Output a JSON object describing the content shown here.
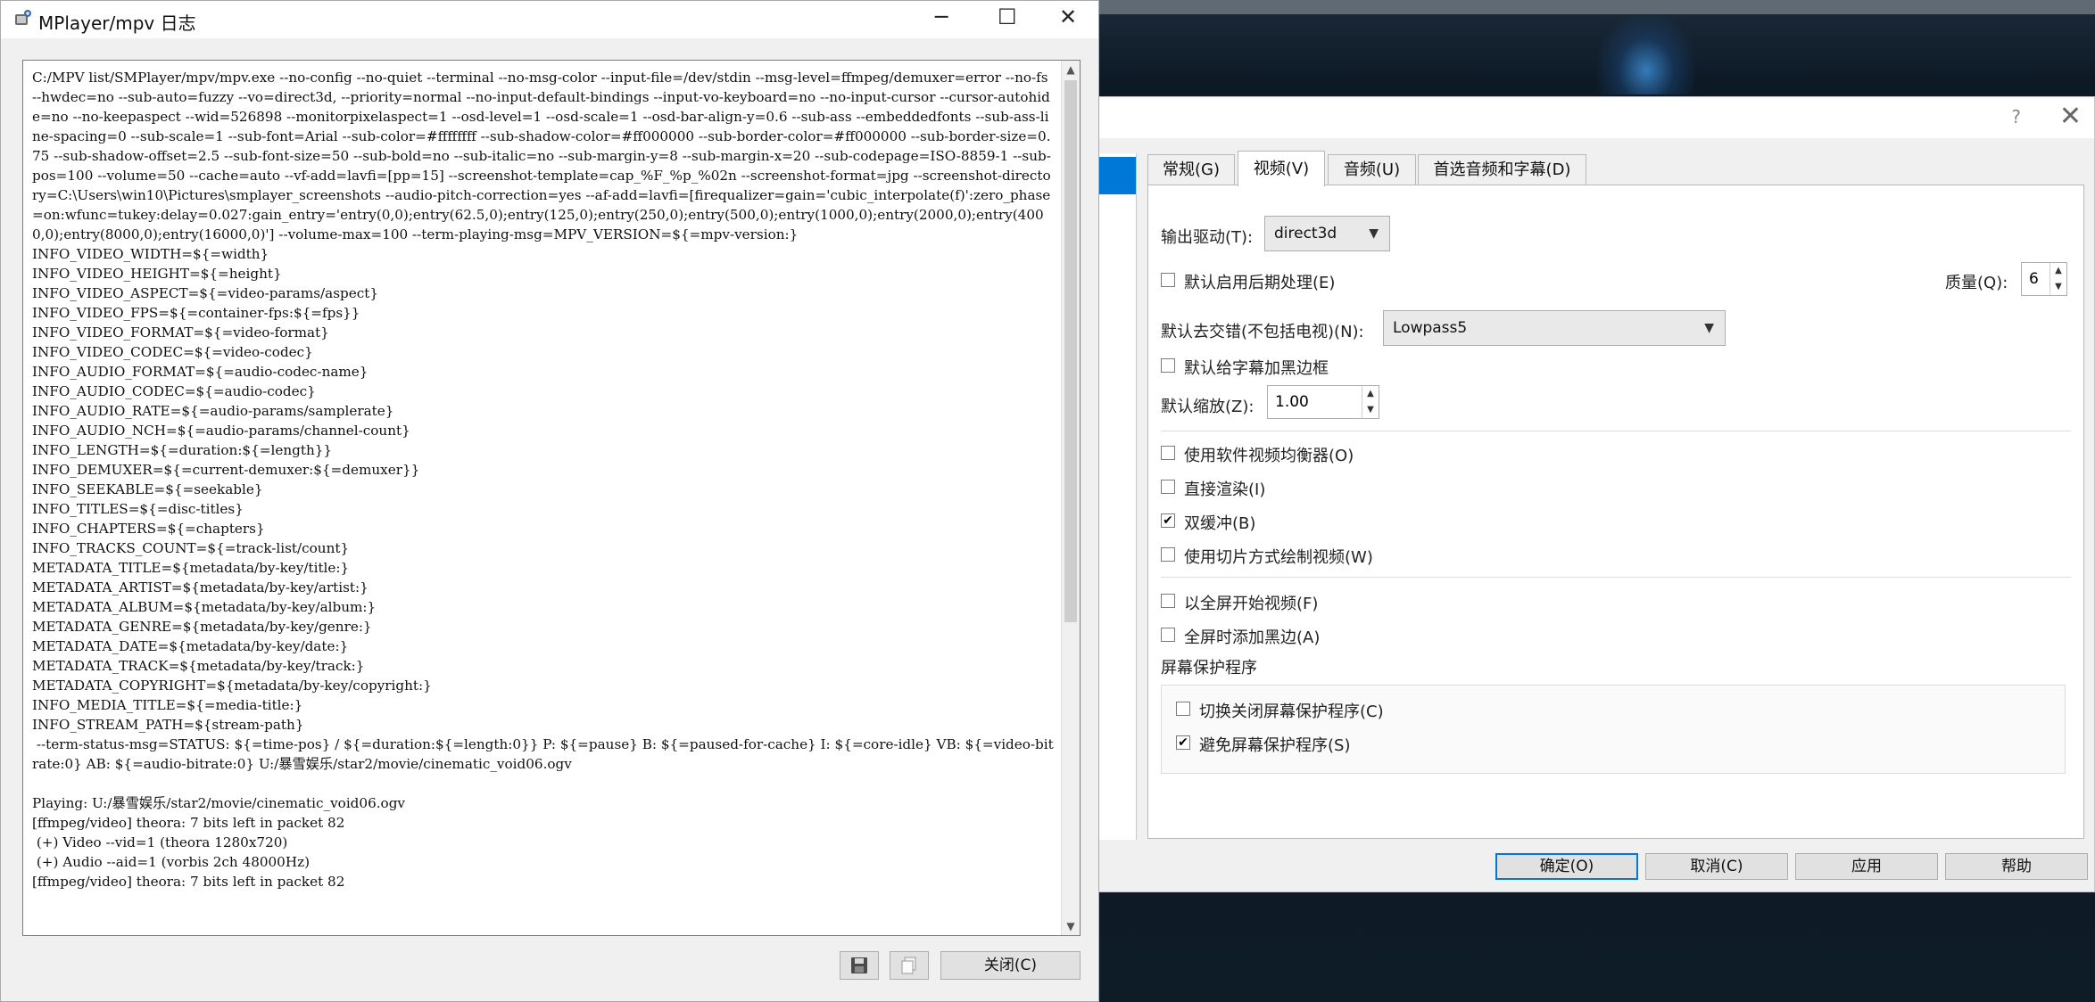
{
  "log_window": {
    "title": "MPlayer/mpv 日志",
    "controls": {
      "minimize": "─",
      "maximize": "☐",
      "close": "✕"
    },
    "log_text": "C:/MPV list/SMPlayer/mpv/mpv.exe --no-config --no-quiet --terminal --no-msg-color --input-file=/dev/stdin --msg-level=ffmpeg/demuxer=error --no-fs --hwdec=no --sub-auto=fuzzy --vo=direct3d, --priority=normal --no-input-default-bindings --input-vo-keyboard=no --no-input-cursor --cursor-autohide=no --no-keepaspect --wid=526898 --monitorpixelaspect=1 --osd-level=1 --osd-scale=1 --osd-bar-align-y=0.6 --sub-ass --embeddedfonts --sub-ass-line-spacing=0 --sub-scale=1 --sub-font=Arial --sub-color=#ffffffff --sub-shadow-color=#ff000000 --sub-border-color=#ff000000 --sub-border-size=0.75 --sub-shadow-offset=2.5 --sub-font-size=50 --sub-bold=no --sub-italic=no --sub-margin-y=8 --sub-margin-x=20 --sub-codepage=ISO-8859-1 --sub-pos=100 --volume=50 --cache=auto --vf-add=lavfi=[pp=15] --screenshot-template=cap_%F_%p_%02n --screenshot-format=jpg --screenshot-directory=C:\\Users\\win10\\Pictures\\smplayer_screenshots --audio-pitch-correction=yes --af-add=lavfi=[firequalizer=gain='cubic_interpolate(f)':zero_phase=on:wfunc=tukey:delay=0.027:gain_entry='entry(0,0);entry(62.5,0);entry(125,0);entry(250,0);entry(500,0);entry(1000,0);entry(2000,0);entry(4000,0);entry(8000,0);entry(16000,0)'] --volume-max=100 --term-playing-msg=MPV_VERSION=${=mpv-version:}\nINFO_VIDEO_WIDTH=${=width}\nINFO_VIDEO_HEIGHT=${=height}\nINFO_VIDEO_ASPECT=${=video-params/aspect}\nINFO_VIDEO_FPS=${=container-fps:${=fps}}\nINFO_VIDEO_FORMAT=${=video-format}\nINFO_VIDEO_CODEC=${=video-codec}\nINFO_AUDIO_FORMAT=${=audio-codec-name}\nINFO_AUDIO_CODEC=${=audio-codec}\nINFO_AUDIO_RATE=${=audio-params/samplerate}\nINFO_AUDIO_NCH=${=audio-params/channel-count}\nINFO_LENGTH=${=duration:${=length}}\nINFO_DEMUXER=${=current-demuxer:${=demuxer}}\nINFO_SEEKABLE=${=seekable}\nINFO_TITLES=${=disc-titles}\nINFO_CHAPTERS=${=chapters}\nINFO_TRACKS_COUNT=${=track-list/count}\nMETADATA_TITLE=${metadata/by-key/title:}\nMETADATA_ARTIST=${metadata/by-key/artist:}\nMETADATA_ALBUM=${metadata/by-key/album:}\nMETADATA_GENRE=${metadata/by-key/genre:}\nMETADATA_DATE=${metadata/by-key/date:}\nMETADATA_TRACK=${metadata/by-key/track:}\nMETADATA_COPYRIGHT=${metadata/by-key/copyright:}\nINFO_MEDIA_TITLE=${=media-title:}\nINFO_STREAM_PATH=${stream-path}\n --term-status-msg=STATUS: ${=time-pos} / ${=duration:${=length:0}} P: ${=pause} B: ${=paused-for-cache} I: ${=core-idle} VB: ${=video-bitrate:0} AB: ${=audio-bitrate:0} U:/暴雪娱乐/star2/movie/cinematic_void06.ogv\n\nPlaying: U:/暴雪娱乐/star2/movie/cinematic_void06.ogv\n[ffmpeg/video] theora: 7 bits left in packet 82\n (+) Video --vid=1 (theora 1280x720)\n (+) Audio --aid=1 (vorbis 2ch 48000Hz)\n[ffmpeg/video] theora: 7 bits left in packet 82",
    "buttons": {
      "save_icon": "save-icon",
      "copy_icon": "copy-icon",
      "close_label": "关闭(C)"
    }
  },
  "preferences": {
    "help_glyph": "?",
    "close_glyph": "✕",
    "tabs": [
      "常规(G)",
      "视频(V)",
      "音频(U)",
      "首选音频和字幕(D)"
    ],
    "active_tab": "视频(V)",
    "output_driver_label": "输出驱动(T):",
    "output_driver_value": "direct3d",
    "postprocessing_label": "默认启用后期处理(E)",
    "postprocessing_checked": false,
    "quality_label": "质量(Q):",
    "quality_value": "6",
    "deinterlace_label": "默认去交错(不包括电视)(N):",
    "deinterlace_value": "Lowpass5",
    "sub_black_border_label": "默认给字幕加黑边框",
    "sub_black_border_checked": false,
    "zoom_label": "默认缩放(Z):",
    "zoom_value": "1.00",
    "software_eq_label": "使用软件视频均衡器(O)",
    "software_eq_checked": false,
    "direct_render_label": "直接渲染(I)",
    "direct_render_checked": false,
    "double_buffer_label": "双缓冲(B)",
    "double_buffer_checked": true,
    "slices_label": "使用切片方式绘制视频(W)",
    "slices_checked": false,
    "start_fullscreen_label": "以全屏开始视频(F)",
    "start_fullscreen_checked": false,
    "fullscreen_borders_label": "全屏时添加黑边(A)",
    "fullscreen_borders_checked": false,
    "screensaver_header": "屏幕保护程序",
    "toggle_screensaver_label": "切换关闭屏幕保护程序(C)",
    "toggle_screensaver_checked": false,
    "avoid_screensaver_label": "避免屏幕保护程序(S)",
    "avoid_screensaver_checked": true,
    "buttons": {
      "ok": "确定(O)",
      "cancel": "取消(C)",
      "apply": "应用",
      "help": "帮助"
    }
  },
  "colors": {
    "accent": "#0078d7",
    "dialog_bg": "#f0f0f0"
  }
}
